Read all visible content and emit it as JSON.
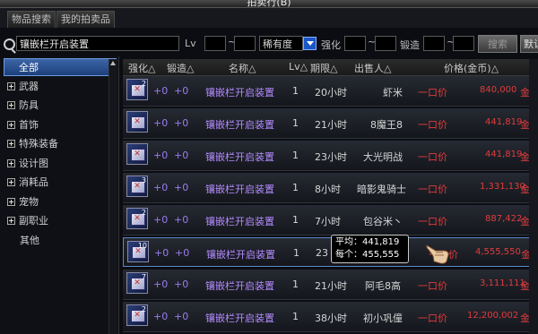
{
  "window": {
    "title": "拍卖行(B)"
  },
  "tabs": [
    {
      "label": "物品搜索"
    },
    {
      "label": "我的拍卖品"
    }
  ],
  "search": {
    "query": "镶嵌栏开启装置",
    "lv_label": "Lv",
    "lv_min": "",
    "lv_sep": "~",
    "lv_max": "",
    "rarity_label": "稀有度",
    "enhance_label": "强化",
    "enhance_sep": "~",
    "forge_label": "锻造",
    "forge_sep": "~",
    "search_button": "搜索",
    "default_button": "默认"
  },
  "categories": [
    {
      "label": "全部",
      "expandable": false,
      "selected": true
    },
    {
      "label": "武器",
      "expandable": true
    },
    {
      "label": "防具",
      "expandable": true
    },
    {
      "label": "首饰",
      "expandable": true
    },
    {
      "label": "特殊装备",
      "expandable": true
    },
    {
      "label": "设计图",
      "expandable": true
    },
    {
      "label": "消耗品",
      "expandable": true
    },
    {
      "label": "宠物",
      "expandable": true
    },
    {
      "label": "副职业",
      "expandable": true
    },
    {
      "label": "其他",
      "expandable": false
    }
  ],
  "table": {
    "headers": {
      "enhance": "强化△",
      "forge": "锻造△",
      "name": "名称△",
      "lv": "Lv△",
      "period": "期限△",
      "seller": "出售人△",
      "price": "价格(金币)△"
    },
    "rows": [
      {
        "qty": "2",
        "enhance": "+0",
        "forge": "+0",
        "name": "镶嵌栏开启装置",
        "lv": "1",
        "period": "20小时",
        "seller": "虾米",
        "buyout": "一口价",
        "price": "840,000",
        "price_unit": "金币"
      },
      {
        "qty": "",
        "enhance": "+0",
        "forge": "+0",
        "name": "镶嵌栏开启装置",
        "lv": "1",
        "period": "21小时",
        "seller": "8魔王8",
        "buyout": "一口价",
        "price": "441,819",
        "price_unit": "金币"
      },
      {
        "qty": "",
        "enhance": "+0",
        "forge": "+0",
        "name": "镶嵌栏开启装置",
        "lv": "1",
        "period": "23小时",
        "seller": "大光明战",
        "buyout": "一口价",
        "price": "441,819",
        "price_unit": "金币"
      },
      {
        "qty": "3",
        "enhance": "+0",
        "forge": "+0",
        "name": "镶嵌栏开启装置",
        "lv": "1",
        "period": "8小时",
        "seller": "暗影鬼骑士",
        "buyout": "一口价",
        "price": "1,331,130",
        "price_unit": "金币"
      },
      {
        "qty": "2",
        "enhance": "+0",
        "forge": "+0",
        "name": "镶嵌栏开启装置",
        "lv": "1",
        "period": "7小时",
        "seller": "包谷米丶",
        "buyout": "一口价",
        "price": "887,422",
        "price_unit": "金币"
      },
      {
        "qty": "10",
        "enhance": "+0",
        "forge": "+0",
        "name": "镶嵌栏开启装置",
        "lv": "1",
        "period": "23",
        "seller": "",
        "buyout": "一口价",
        "price": "4,555,550",
        "price_unit": "金币",
        "selected": true
      },
      {
        "qty": "7",
        "enhance": "+0",
        "forge": "+0",
        "name": "镶嵌栏开启装置",
        "lv": "1",
        "period": "21小时",
        "seller": "阿毛8高",
        "buyout": "一口价",
        "price": "3,111,111",
        "price_unit": "金币"
      },
      {
        "qty": "2",
        "enhance": "+0",
        "forge": "+0",
        "name": "镶嵌栏开启装置",
        "lv": "1",
        "period": "38小时",
        "seller": "初小巩僮",
        "buyout": "一口价",
        "price": "12,200,002",
        "price_unit": "金币"
      }
    ]
  },
  "tooltip": {
    "avg_label": "平均：",
    "avg_value": "441,819",
    "each_label": "每个：",
    "each_value": "455,555"
  },
  "colors": {
    "selection_blue": "#3c66a8",
    "name_purple": "#b48bff",
    "price_red": "#e03c3c",
    "rarity_dropdown": "#1a56c6"
  }
}
